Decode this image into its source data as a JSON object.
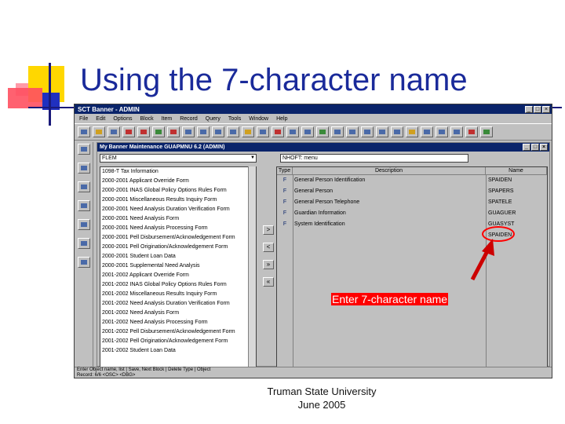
{
  "slide": {
    "title": "Using the 7-character name",
    "annotation": "Enter 7-character name",
    "footer_line1": "Truman State University",
    "footer_line2": "June 2005"
  },
  "window": {
    "title": "SCT Banner - ADMIN",
    "menu": [
      "File",
      "Edit",
      "Options",
      "Block",
      "Item",
      "Record",
      "Query",
      "Tools",
      "Window",
      "Help"
    ]
  },
  "inner_form": {
    "title": "My Banner Maintenance  GUAPMNU  6.2  (ADMIN)",
    "dropdown_value": "FLEM",
    "text_value": "NHOFT: menu",
    "list_items": [
      "1098-T Tax Information",
      "2000-2001 Applicant Override Form",
      "2000-2001 INAS Global Policy Options Rules Form",
      "2000-2001 Miscellaneous Results Inquiry Form",
      "2000-2001 Need Analysis Duration Verification Form",
      "2000-2001 Need Analysis Form",
      "2000-2001 Need Analysis Processing Form",
      "2000-2001 Pell Disbursement/Acknowledgement Form",
      "2000-2001 Pell Origination/Acknowledgement Form",
      "2000-2001 Student Loan Data",
      "2000-2001 Supplemental Need Analysis",
      "2001-2002 Applicant Override Form",
      "2001-2002 INAS Global Policy Options Rules Form",
      "2001-2002 Miscellaneous Results Inquiry Form",
      "2001-2002 Need Analysis Duration Verification Form",
      "2001-2002 Need Analysis Form",
      "2001-2002 Need Analysis Processing Form",
      "2001-2002 Pell Disbursement/Acknowledgement Form",
      "2001-2002 Pell Origination/Acknowledgement Form",
      "2001-2002 Student Loan Data"
    ],
    "grid_headers": [
      "Type",
      "Description",
      "Name"
    ],
    "grid_rows": [
      {
        "type": "F",
        "description": "General Person Identification",
        "name": "SPAIDEN"
      },
      {
        "type": "F",
        "description": "General Person",
        "name": "SPAPERS"
      },
      {
        "type": "F",
        "description": "General Person Telephone",
        "name": "SPATELE"
      },
      {
        "type": "F",
        "description": "Guardian Information",
        "name": "GUAGUER"
      },
      {
        "type": "F",
        "description": "System Identification",
        "name": "GUASYST"
      },
      {
        "type": "",
        "description": "",
        "name": "SPAIDEN"
      }
    ],
    "status_line1": "Enter Object name, list | Save, Next Block | Delete Type | Object",
    "status_line2": "Record: 6/6   <OSC>  <DBG>"
  },
  "colors": {
    "title_blue": "#1a2a9a",
    "annotation_red": "#ff0000",
    "titlebar_navy": "#0a246a"
  }
}
